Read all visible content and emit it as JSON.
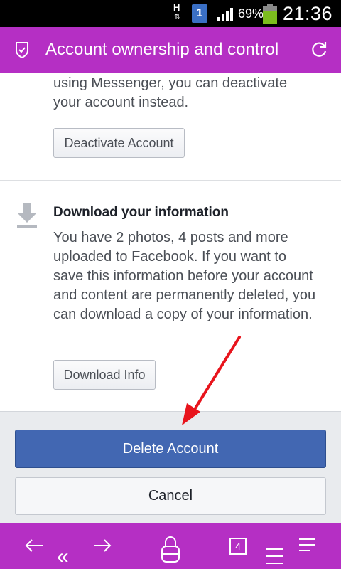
{
  "status_bar": {
    "network_type": "H",
    "sim_slot": "1",
    "battery_percent": "69%",
    "battery_level": 0.69,
    "time": "21:36"
  },
  "header": {
    "title": "Account ownership and control",
    "left_icon": "shield-check-icon",
    "right_icon": "refresh-icon",
    "bg_color": "#b52fc4"
  },
  "content": {
    "top_paragraph": "using Messenger, you can deactivate your account instead.",
    "deactivate_button": "Deactivate Account",
    "download_section": {
      "icon": "download-icon",
      "heading": "Download your information",
      "body": "You have 2 photos, 4 posts and more uploaded to Facebook. If you want to save this information before your account and content are permanently deleted, you can download a copy of your information.",
      "button": "Download Info"
    }
  },
  "actions": {
    "delete_label": "Delete Account",
    "cancel_label": "Cancel",
    "delete_color": "#4267b2"
  },
  "annotation": {
    "arrow_color": "#e8141c"
  },
  "bottom_nav": {
    "tab_count": "4",
    "icons": [
      "back-icon",
      "rewind-icon",
      "forward-icon",
      "lock-icon",
      "tabs-icon",
      "scroll-icon",
      "menu-icon"
    ]
  }
}
